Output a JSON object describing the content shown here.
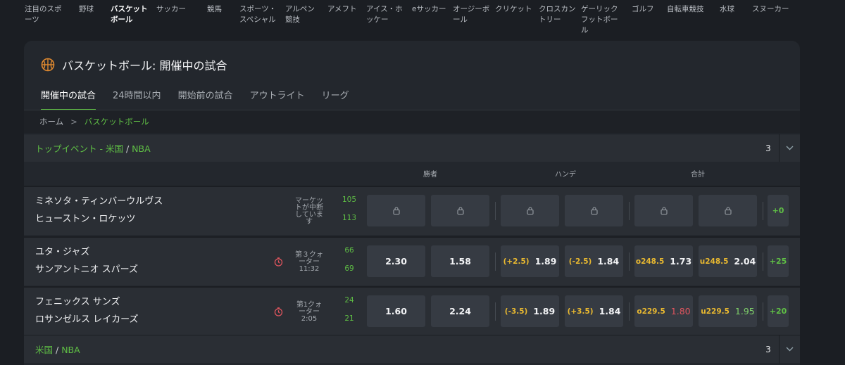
{
  "sport_nav": [
    {
      "label": "注目のスポ\nーツ",
      "active": false
    },
    {
      "label": "野球",
      "active": false
    },
    {
      "label": "バスケット\nボール",
      "active": true
    },
    {
      "label": "サッカー",
      "active": false
    },
    {
      "label": "競馬",
      "active": false
    },
    {
      "label": "スポーツ・\nスペシャル",
      "active": false
    },
    {
      "label": "アルペン\n競技",
      "active": false
    },
    {
      "label": "アメフト",
      "active": false
    },
    {
      "label": "アイス・ホ\nッケー",
      "active": false
    },
    {
      "label": "eサッカー",
      "active": false
    },
    {
      "label": "オージーボ\nール",
      "active": false
    },
    {
      "label": "クリケット",
      "active": false
    },
    {
      "label": "クロスカン\nトリー",
      "active": false
    },
    {
      "label": "ゲーリック\nフットボー\nル",
      "active": false
    },
    {
      "label": "ゴルフ",
      "active": false
    },
    {
      "label": "自転車競技",
      "active": false
    },
    {
      "label": "水球",
      "active": false
    },
    {
      "label": "スヌーカー",
      "active": false
    }
  ],
  "header": {
    "icon": "basketball-icon",
    "title": "バスケットボール: 開催中の試合",
    "tabs": [
      {
        "label": "開催中の試合",
        "active": true
      },
      {
        "label": "24時間以内",
        "active": false
      },
      {
        "label": "開始前の試合",
        "active": false
      },
      {
        "label": "アウトライト",
        "active": false
      },
      {
        "label": "リーグ",
        "active": false
      }
    ]
  },
  "breadcrumb": {
    "home": "ホーム",
    "separator": ">",
    "current": "バスケットボール"
  },
  "sections": [
    {
      "title_a": "トップイベント - 米国",
      "slash": "/",
      "title_b": "NBA",
      "count": "3"
    },
    {
      "title_a": "米国",
      "slash": "/",
      "title_b": "NBA",
      "count": "3"
    }
  ],
  "columns": {
    "winner": "勝者",
    "handicap": "ハンデ",
    "total": "合計"
  },
  "matches": [
    {
      "home": "ミネソタ・ティンバーウルヴス",
      "away": "ヒューストン・ロケッツ",
      "status_lines": [
        "マーケッ",
        "トが中断",
        "していま",
        "す"
      ],
      "clock": false,
      "score_home": "105",
      "score_away": "113",
      "locked": true,
      "odds": [],
      "more": "+0"
    },
    {
      "home": "ユタ・ジャズ",
      "away": "サンアントニオ スパーズ",
      "status_lines": [
        "第３クォ",
        "ーター",
        "11:32"
      ],
      "clock": true,
      "score_home": "66",
      "score_away": "69",
      "locked": false,
      "odds": [
        {
          "pre": "",
          "val": "2.30",
          "trend": ""
        },
        {
          "pre": "",
          "val": "1.58",
          "trend": ""
        },
        {
          "pre": "(+2.5)",
          "val": "1.89",
          "trend": ""
        },
        {
          "pre": "(-2.5)",
          "val": "1.84",
          "trend": ""
        },
        {
          "pre": "o248.5",
          "val": "1.73",
          "trend": ""
        },
        {
          "pre": "u248.5",
          "val": "2.04",
          "trend": ""
        }
      ],
      "more": "+25"
    },
    {
      "home": "フェニックス サンズ",
      "away": "ロサンゼルス レイカーズ",
      "status_lines": [
        "第1クォ",
        "ーター",
        "2:05"
      ],
      "clock": true,
      "score_home": "24",
      "score_away": "21",
      "locked": false,
      "odds": [
        {
          "pre": "",
          "val": "1.60",
          "trend": ""
        },
        {
          "pre": "",
          "val": "2.24",
          "trend": ""
        },
        {
          "pre": "(-3.5)",
          "val": "1.89",
          "trend": ""
        },
        {
          "pre": "(+3.5)",
          "val": "1.84",
          "trend": ""
        },
        {
          "pre": "o229.5",
          "val": "1.80",
          "trend": "down"
        },
        {
          "pre": "u229.5",
          "val": "1.95",
          "trend": "up"
        }
      ],
      "more": "+20"
    }
  ],
  "colors": {
    "accent": "#5fbf45",
    "panel": "#23272d",
    "row": "#2a2e34",
    "odds_button": "#363b43",
    "handicap_line": "#e8b830",
    "odds_down": "#e0555e",
    "odds_up": "#7fd16a",
    "clock": "#e0555e"
  }
}
